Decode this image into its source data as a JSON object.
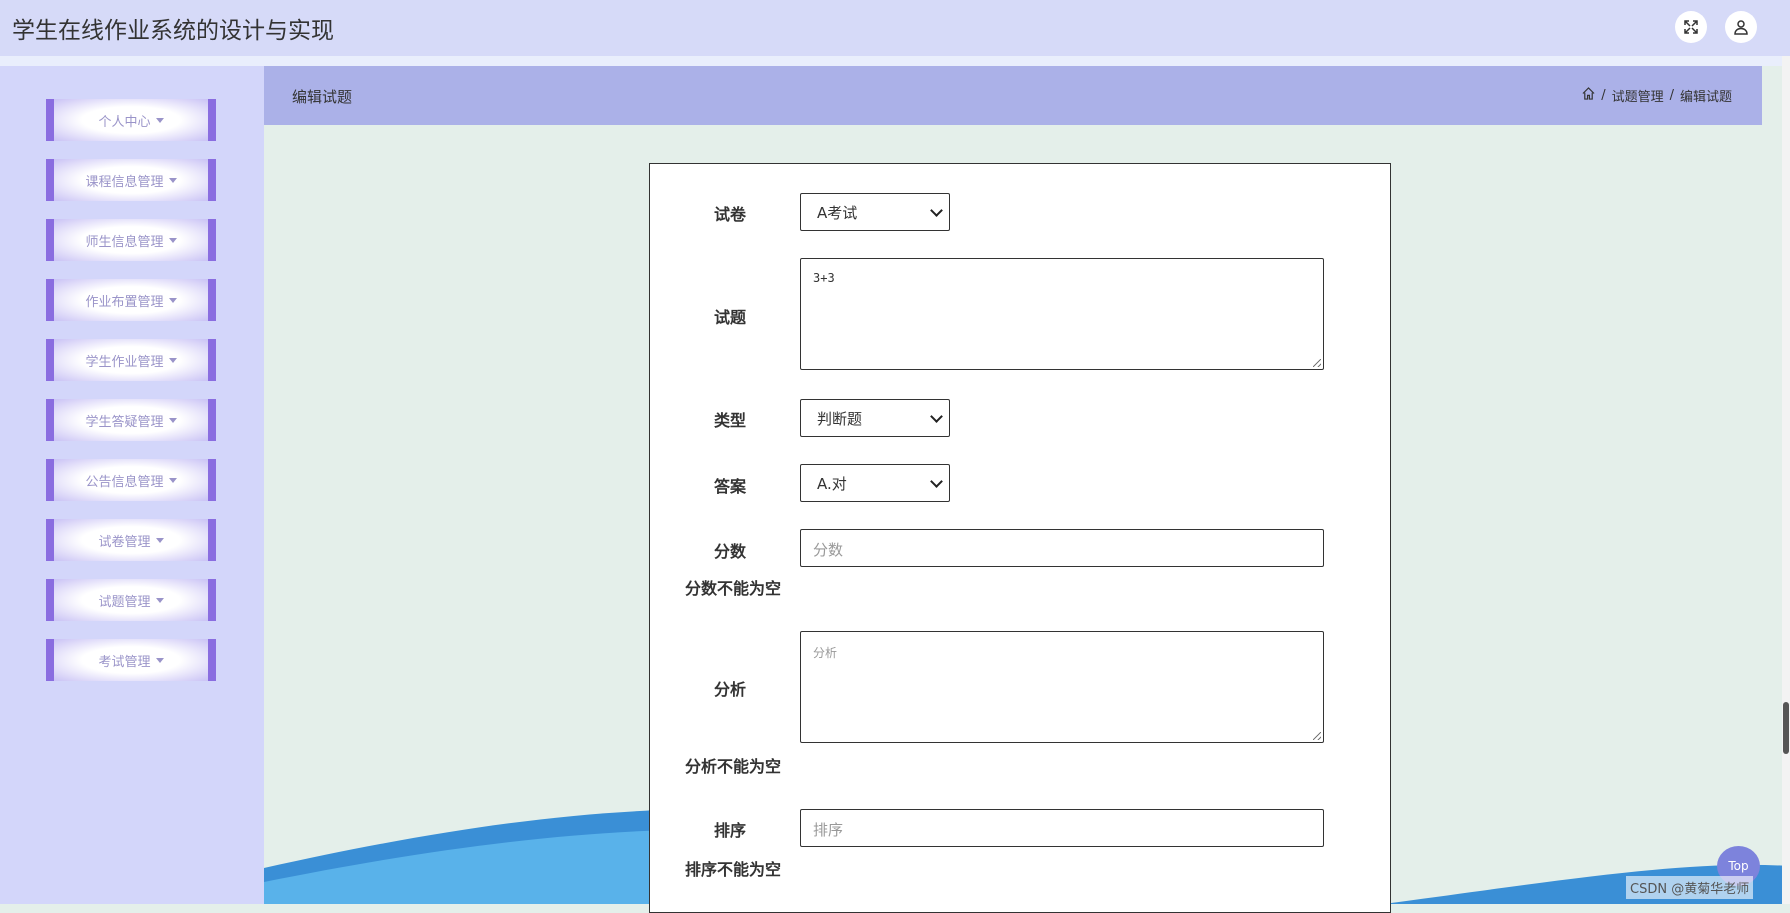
{
  "app": {
    "title": "学生在线作业系统的设计与实现"
  },
  "topbar_icons": [
    "fullscreen-icon",
    "user-icon"
  ],
  "sidebar": {
    "items": [
      {
        "label": "个人中心"
      },
      {
        "label": "课程信息管理"
      },
      {
        "label": "师生信息管理"
      },
      {
        "label": "作业布置管理"
      },
      {
        "label": "学生作业管理"
      },
      {
        "label": "学生答疑管理"
      },
      {
        "label": "公告信息管理"
      },
      {
        "label": "试卷管理"
      },
      {
        "label": "试题管理"
      },
      {
        "label": "考试管理"
      }
    ]
  },
  "header": {
    "title": "编辑试题",
    "breadcrumb": {
      "sep": "/",
      "items": [
        "试题管理",
        "编辑试题"
      ]
    }
  },
  "form": {
    "paper": {
      "label": "试卷",
      "value": "A考试"
    },
    "question": {
      "label": "试题",
      "value": "3+3"
    },
    "type": {
      "label": "类型",
      "value": "判断题"
    },
    "answer": {
      "label": "答案",
      "value": "A.对"
    },
    "score": {
      "label": "分数",
      "placeholder": "分数",
      "error": "分数不能为空"
    },
    "analysis": {
      "label": "分析",
      "placeholder": "分析",
      "error": "分析不能为空"
    },
    "order": {
      "label": "排序",
      "placeholder": "排序",
      "error": "排序不能为空"
    }
  },
  "top_button": "Top",
  "watermark": "CSDN @黄菊华老师"
}
